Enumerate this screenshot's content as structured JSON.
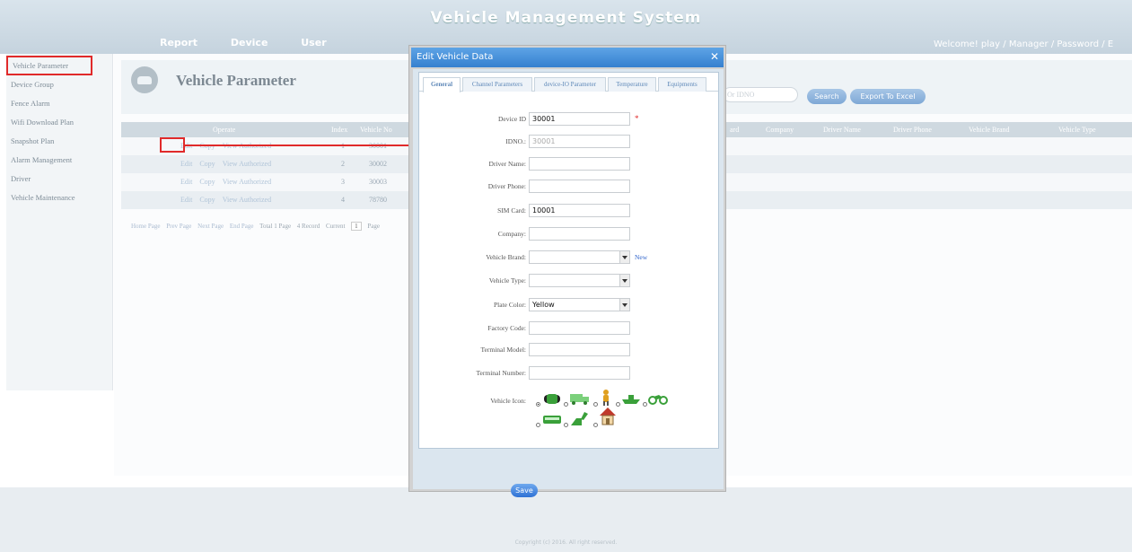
{
  "header": {
    "app_title": "Vehicle Management System",
    "nav": [
      "Report",
      "Device",
      "User"
    ],
    "welcome": "Welcome! play / Manager / Password / E"
  },
  "sidebar": {
    "items": [
      "Vehicle Parameter",
      "Device Group",
      "Fence Alarm",
      "Wifi Download Plan",
      "Snapshot Plan",
      "Alarm Management",
      "Driver",
      "Vehicle Maintenance"
    ]
  },
  "page": {
    "title": "Vehicle Parameter",
    "search_placeholder": "Or IDNO",
    "search_button": "Search",
    "export_button": "Export To Excel"
  },
  "table": {
    "headers": [
      "Operate",
      "Index",
      "Vehicle No",
      "ard",
      "Company",
      "Driver Name",
      "Driver Phone",
      "Vehicle Brand",
      "Vehicle Type"
    ],
    "ops": [
      "Edit",
      "Copy",
      "View Authorized"
    ],
    "rows": [
      {
        "index": "1",
        "vehicle_no": "30001"
      },
      {
        "index": "2",
        "vehicle_no": "30002"
      },
      {
        "index": "3",
        "vehicle_no": "30003"
      },
      {
        "index": "4",
        "vehicle_no": "78780"
      }
    ]
  },
  "pager": {
    "home": "Home Page",
    "prev": "Prev Page",
    "next": "Next Page",
    "end": "End Page",
    "total": "Total 1 Page",
    "records": "4 Record",
    "current_label": "Current",
    "current": "1",
    "page_label": "Page"
  },
  "modal": {
    "title": "Edit Vehicle Data",
    "tabs": [
      "General",
      "Channel Parameters",
      "device-IO Parameter",
      "Temperature",
      "Equipments"
    ],
    "fields": {
      "device_id": {
        "label": "Device ID",
        "value": "30001"
      },
      "idno": {
        "label": "IDNO.:",
        "value": "30001"
      },
      "driver_name": {
        "label": "Driver Name:",
        "value": ""
      },
      "driver_phone": {
        "label": "Driver Phone:",
        "value": ""
      },
      "sim_card": {
        "label": "SIM Card:",
        "value": "10001"
      },
      "company": {
        "label": "Company:",
        "value": ""
      },
      "vehicle_brand": {
        "label": "Vehicle Brand:",
        "value": ""
      },
      "vehicle_type": {
        "label": "Vehicle Type:",
        "value": ""
      },
      "plate_color": {
        "label": "Plate Color:",
        "value": "Yellow"
      },
      "factory_code": {
        "label": "Factory Code:",
        "value": ""
      },
      "terminal_model": {
        "label": "Terminal Model:",
        "value": ""
      },
      "terminal_number": {
        "label": "Terminal Number:",
        "value": ""
      },
      "vehicle_icon": {
        "label": "Vehicle Icon:"
      }
    },
    "new_link": "New",
    "vehicle_icons": [
      "car-icon",
      "truck-icon",
      "person-icon",
      "boat-icon",
      "motorcycle-icon",
      "bus-icon",
      "excavator-icon",
      "house-icon"
    ],
    "selected_icon": "car-icon",
    "save": "Save"
  },
  "footer": {
    "copyright": "Copyright (c) 2016. All right reserved."
  },
  "colors": {
    "accent": "#3580cf",
    "highlight": "#e02a2a",
    "icon_green": "#3aa03a"
  }
}
